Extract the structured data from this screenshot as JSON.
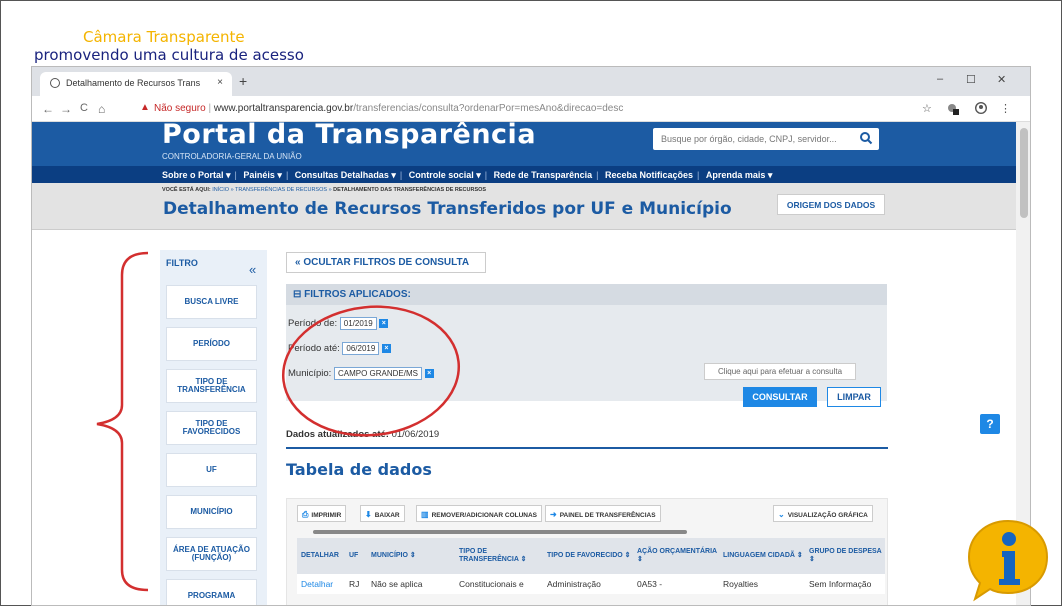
{
  "slide": {
    "title": "Câmara Transparente",
    "subtitle": "promovendo uma cultura de acesso"
  },
  "browser": {
    "tab_title": "Detalhamento de Recursos Trans",
    "tab_close": "×",
    "new_tab": "+",
    "window_controls": [
      "–",
      "☐",
      "✕"
    ],
    "nav": [
      "←",
      "→",
      "C",
      "⌂"
    ],
    "security_label": "Não seguro",
    "url_domain": "www.portaltransparencia.gov.br",
    "url_path": "/transferencias/consulta?ordenarPor=mesAno&direcao=desc",
    "right_icons": [
      "☆",
      "⋮"
    ]
  },
  "portal": {
    "logo": "Portal da Transparência",
    "sublogo": "CONTROLADORIA-GERAL DA UNIÃO",
    "search_placeholder": "Busque por órgão, cidade, CNPJ, servidor...",
    "search_icon": "magnifier",
    "menu": [
      "Sobre o Portal ▾",
      "Painéis ▾",
      "Consultas Detalhadas ▾",
      "Controle social ▾",
      "Rede de Transparência",
      "Receba Notificações",
      "Aprenda mais ▾"
    ],
    "breadcrumb_lead": "VOCÊ ESTÁ AQUI:",
    "breadcrumb": "INÍCIO » TRANSFERÊNCIAS DE RECURSOS » ",
    "breadcrumb_current": "DETALHAMENTO DAS TRANSFERÊNCIAS DE RECURSOS",
    "page_title": "Detalhamento de Recursos Transferidos por UF e Município",
    "origem_button": "ORIGEM DOS DADOS"
  },
  "filter_sidebar": {
    "title": "FILTRO",
    "collapse": "«",
    "items": [
      "BUSCA LIVRE",
      "PERÍODO",
      "TIPO DE TRANSFERÊNCIA",
      "TIPO DE FAVORECIDOS",
      "UF",
      "MUNICÍPIO",
      "ÁREA DE ATUAÇÃO (FUNÇÃO)",
      "PROGRAMA"
    ]
  },
  "filters": {
    "hide_button": "« OCULTAR FILTROS DE CONSULTA",
    "applied_title": "FILTROS APLICADOS:",
    "applied_toggle": "⊟",
    "periodo_de_label": "Período de:",
    "periodo_de_value": "01/2019",
    "periodo_ate_label": "Período até:",
    "periodo_ate_value": "06/2019",
    "municipio_label": "Município:",
    "municipio_value": "CAMPO GRANDE/MS",
    "remove_mark": "×",
    "hint": "Clique aqui para efetuar a consulta",
    "consultar": "CONSULTAR",
    "limpar": "LIMPAR"
  },
  "data_info": {
    "label": "Dados atualizados até:",
    "date": "01/06/2019"
  },
  "table": {
    "title": "Tabela de dados",
    "toolbar": {
      "imprimir": "IMPRIMIR",
      "baixar": "BAIXAR",
      "colunas": "REMOVER/ADICIONAR COLUNAS",
      "painel": "PAINEL DE TRANSFERÊNCIAS",
      "grafica": "VISUALIZAÇÃO GRÁFICA"
    },
    "columns": [
      "DETALHAR",
      "UF",
      "MUNICÍPIO ⇕",
      "TIPO DE TRANSFERÊNCIA ⇕",
      "TIPO DE FAVORECIDO ⇕",
      "AÇÃO ORÇAMENTÁRIA ⇕",
      "LINGUAGEM CIDADÃ ⇕",
      "GRUPO DE DESPESA ⇕"
    ],
    "rows": [
      [
        "Detalhar",
        "RJ",
        "Não se aplica",
        "Constitucionais e",
        "Administração",
        "0A53 -",
        "Royalties",
        "Sem Informação"
      ]
    ]
  },
  "help_button": "?",
  "colors": {
    "header_blue": "#1c5ba3",
    "menu_navy": "#0b3e82",
    "accent_blue": "#1e88e5",
    "annotation_red": "#d32f2f",
    "slide_title_yellow": "#f4b400"
  }
}
